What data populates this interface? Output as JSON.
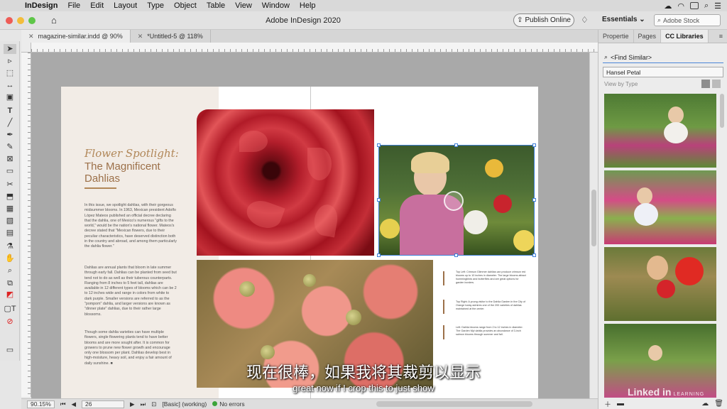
{
  "menubar": {
    "app_name": "InDesign",
    "items": [
      "File",
      "Edit",
      "Layout",
      "Type",
      "Object",
      "Table",
      "View",
      "Window",
      "Help"
    ]
  },
  "appbar": {
    "title": "Adobe InDesign 2020",
    "publish_label": "Publish Online",
    "workspace": "Essentials",
    "stock_placeholder": "Adobe Stock"
  },
  "tabs": [
    {
      "label": "magazine-similar.indd @ 90%",
      "active": true
    },
    {
      "label": "*Untitled-5 @ 118%",
      "active": false
    }
  ],
  "document": {
    "script_title": "Flower Spotlight:",
    "title": "The Magnificent Dahlias",
    "body_paragraphs": [
      "In this issue, we spotlight dahlias, with their gorgeous midsummer blooms. In 1963, Mexican president Adolfo López Mateos published an official decree declaring that the dahlia, one of Mexico's numerous \"gifts to the world,\" would be the nation's national flower. Mateos's decree stated that \"Mexican flowers, due to their peculiar characteristics, have deserved distinction both in the country and abroad, and among them particularly the dahlia flower.\"",
      "Dahlias are annual plants that bloom in late summer through early fall. Dahlias can be planted from seed but tend not to do as well as their tuberous counterparts. Ranging from 8 inches to 5 feet tall, dahlias are available in 12 different types of blooms which can be 2 to 12 inches wide and range in colors from white to dark purple. Smaller versions are referred to as the \"pompom\" dahlia, and larger versions are known as \"dinner plate\" dahlias, due to their rather large blossoms.",
      "Though some dahlia varieties can have multiple flowers, single flowering plants tend to have better blooms and are more sought after. It is common for growers to prune new flower growth and encourage only one blossom per plant. Dahlias develop best in high-moisture, heavy soil, and enjoy a fair amount of daily sunshine. ■"
    ],
    "captions": [
      "Top Left: Crimson Glimmer dahlias can produce crimson red blooms up to 10 inches in diameter. The large blooms attract hummingbirds and butterflies and are great options for garden borders.",
      "Top Right: A young visitor to the Dahlia Garden in the City of Orange today admires one of the 200 varieties of dahlias maintained at the center.",
      "Left: Dahlia blooms range from 2 to 12 inches in diameter. The Garden Myl dahlia provides an abundance of 3-inch salmon blooms through summer and fall."
    ]
  },
  "panel": {
    "tabs": [
      "Propertie",
      "Pages",
      "CC Libraries"
    ],
    "active_tab": "CC Libraries",
    "find_similar": "<Find Similar>",
    "library": "Hansel Petal",
    "view_by": "View by Type"
  },
  "status": {
    "zoom": "90.15%",
    "page": "26",
    "profile": "[Basic] (working)",
    "errors": "No errors"
  },
  "subtitles": {
    "chinese": "现在很棒，如果我将其裁剪以显示",
    "english": "great now if I crop this to just show"
  },
  "watermark": {
    "brand": "Linked in",
    "suffix": "LEARNING"
  },
  "colors": {
    "accent": "#b18758",
    "title": "#9c7049",
    "selection": "#3f7fd8"
  }
}
